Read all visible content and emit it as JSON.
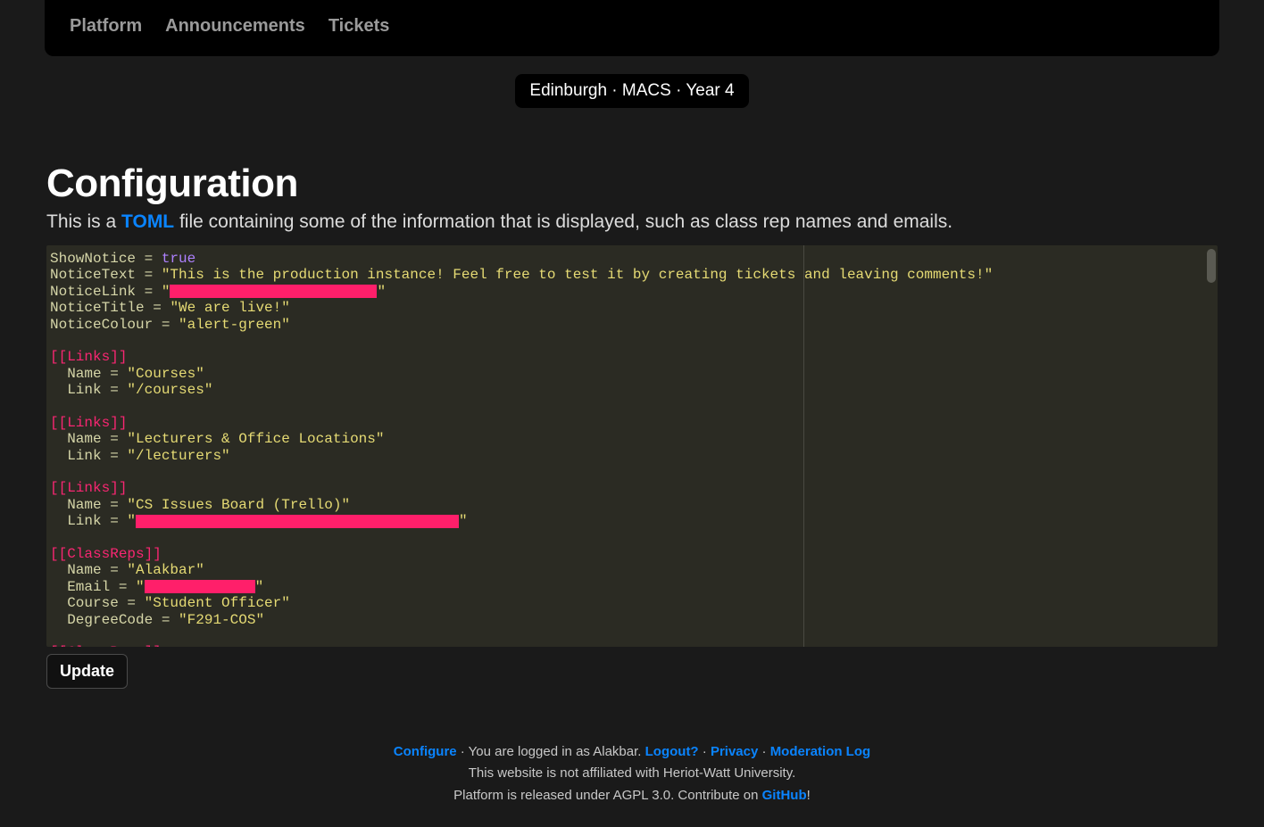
{
  "nav": {
    "platform": "Platform",
    "announcements": "Announcements",
    "tickets": "Tickets"
  },
  "context_pill": "Edinburgh · MACS · Year 4",
  "page": {
    "title": "Configuration",
    "desc_prefix": "This is a ",
    "desc_link": "TOML",
    "desc_suffix": " file containing some of the information that is displayed, such as class rep names and emails."
  },
  "toml": {
    "ShowNotice": "true",
    "NoticeText": "\"This is the production instance! Feel free to test it by creating tickets and leaving comments!\"",
    "NoticeLink_open": "\"",
    "NoticeLink_close": "\"",
    "NoticeTitle": "\"We are live!\"",
    "NoticeColour": "\"alert-green\"",
    "links_header": "[[Links]]",
    "link1_name": "\"Courses\"",
    "link1_link": "\"/courses\"",
    "link2_name": "\"Lecturers & Office Locations\"",
    "link2_link": "\"/lecturers\"",
    "link3_name": "\"CS Issues Board (Trello)\"",
    "link3_link_open": "\"",
    "link3_link_close": "\"",
    "classreps_header": "[[ClassReps]]",
    "cr1_name": "\"Alakbar\"",
    "cr1_email_open": "\"",
    "cr1_email_close": "\"",
    "cr1_course": "\"Student Officer\"",
    "cr1_degree": "\"F291-COS\"",
    "key_ShowNotice": "ShowNotice",
    "key_NoticeText": "NoticeText",
    "key_NoticeLink": "NoticeLink",
    "key_NoticeTitle": "NoticeTitle",
    "key_NoticeColour": "NoticeColour",
    "key_Name": "Name",
    "key_Link": "Link",
    "key_Email": "Email",
    "key_Course": "Course",
    "key_DegreeCode": "DegreeCode",
    "eq": " = "
  },
  "update_button": "Update",
  "footer": {
    "configure": "Configure",
    "logged_in_prefix": " · You are logged in as Alakbar. ",
    "logout": "Logout?",
    "sep": " · ",
    "privacy": "Privacy",
    "modlog": "Moderation Log",
    "line2": "This website is not affiliated with Heriot-Watt University.",
    "line3_prefix": "Platform is released under AGPL 3.0. Contribute on ",
    "github": "GitHub",
    "line3_suffix": "!"
  }
}
